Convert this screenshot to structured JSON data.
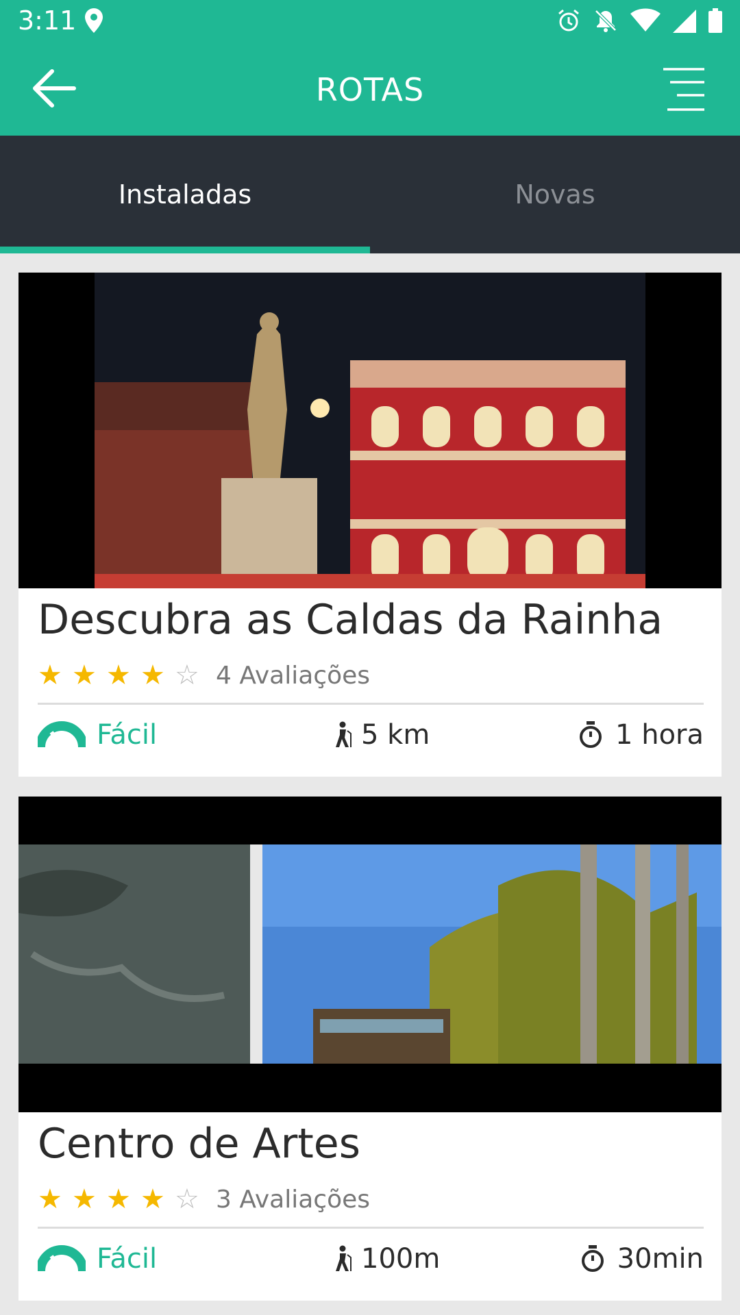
{
  "status": {
    "time": "3:11"
  },
  "appbar": {
    "title": "ROTAS"
  },
  "tabs": [
    {
      "label": "Instaladas",
      "active": true
    },
    {
      "label": "Novas",
      "active": false
    }
  ],
  "routes": [
    {
      "title": "Descubra as Caldas da Rainha",
      "rating": 4,
      "max_rating": 5,
      "reviews": "4 Avaliações",
      "difficulty": "Fácil",
      "distance": "5 km",
      "duration": "1 hora"
    },
    {
      "title": "Centro de Artes",
      "rating": 4,
      "max_rating": 5,
      "reviews": "3 Avaliações",
      "difficulty": "Fácil",
      "distance": "100m",
      "duration": "30min"
    }
  ],
  "colors": {
    "accent": "#1fb894",
    "tabbar": "#2a3038",
    "star": "#f5b800"
  }
}
